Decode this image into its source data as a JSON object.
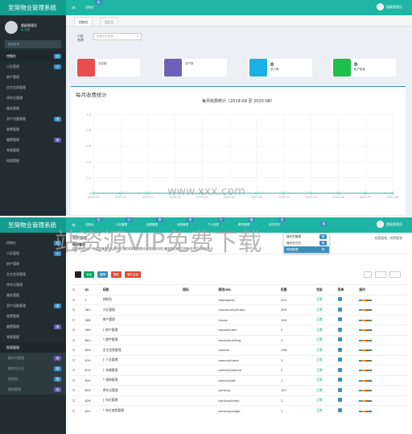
{
  "app": {
    "title": "至简物业管理系统",
    "admin_label": "超级管理员"
  },
  "top": {
    "user": {
      "name": "超级管理员",
      "status": "在线"
    },
    "search_placeholder": "搜索菜单",
    "menu": [
      {
        "label": "控制台",
        "badge": "控",
        "active": true
      },
      {
        "label": "小区管理",
        "badge": "小"
      },
      {
        "label": "房产管理"
      },
      {
        "label": "业主信息管理"
      },
      {
        "label": "停车位管理"
      },
      {
        "label": "服务管理"
      },
      {
        "label": "资产设备管理",
        "badge": "资"
      },
      {
        "label": "收费管理"
      },
      {
        "label": "缴费管理",
        "badge": "缴"
      },
      {
        "label": "常规管理"
      },
      {
        "label": "权限管理"
      }
    ],
    "hdr_tab": "控制台",
    "hdr_badge": "控",
    "tabs": [
      "控制台",
      "固定区"
    ],
    "select_label": "小区\n名称",
    "select_placeholder": "全部小区名称",
    "tiles": [
      {
        "value": "",
        "label": "总收款",
        "color": "#e84e4e"
      },
      {
        "value": "",
        "label": "总户数",
        "color": "#6e5fb8"
      },
      {
        "value": "0",
        "label": "总人数",
        "color": "#1ab0e3"
      },
      {
        "value": "0",
        "label": "租户数量",
        "color": "#1fbf4b"
      }
    ],
    "chart_section": "每月收费统计"
  },
  "chart_data": {
    "type": "line",
    "title": "每月收费统计（2019-09 至 2020-08）",
    "x": [
      "2019-09",
      "2019-10",
      "2019-11",
      "2019-12",
      "2020-01",
      "2020-02",
      "2020-03",
      "2020-04",
      "2020-05",
      "2020-06",
      "2020-07",
      "2020-08"
    ],
    "series": [
      {
        "values": [
          0,
          0,
          0,
          0,
          0,
          0,
          0,
          0,
          0,
          0,
          0,
          0
        ]
      }
    ],
    "yticks": [
      "1.0",
      "0.8",
      "0.6",
      "0.4",
      "0.2",
      "0"
    ],
    "ylim": [
      0,
      1
    ]
  },
  "bottom": {
    "hdr_nav": [
      {
        "label": "控制台",
        "badge": "控"
      },
      {
        "label": "小区管理",
        "badge": "小"
      },
      {
        "label": "房屋管理",
        "badge": "房"
      },
      {
        "label": "收费管理",
        "badge": "收"
      },
      {
        "label": "个人信息",
        "badge": "个"
      },
      {
        "label": "服务管理",
        "badge": "服"
      },
      {
        "label": "定时任务",
        "badge": "定"
      }
    ],
    "hdr_right_badge": "客",
    "dropdown": [
      {
        "label": "操作员管理",
        "badge": "操"
      },
      {
        "label": "操作员日志",
        "badge": "操"
      },
      {
        "label": "规则管理",
        "badge": "规"
      }
    ],
    "menu": [
      {
        "label": "控制台",
        "badge": "控"
      },
      {
        "label": "小区管理",
        "badge": "小"
      },
      {
        "label": "房产管理"
      },
      {
        "label": "业主信息管理"
      },
      {
        "label": "停车位管理"
      },
      {
        "label": "服务管理"
      },
      {
        "label": "资产设备管理",
        "badge": "资"
      },
      {
        "label": "收费管理"
      },
      {
        "label": "缴费管理",
        "badge": "缴"
      },
      {
        "label": "常规管理"
      },
      {
        "label": "权限管理",
        "active": true
      },
      {
        "label": "操作员管理",
        "badge": "操",
        "sub": true
      },
      {
        "label": "操作员日志",
        "badge": "操",
        "sub": true
      },
      {
        "label": "角色组",
        "badge": "角",
        "sub": true
      },
      {
        "label": "规则管理",
        "badge": "规",
        "sub": true
      }
    ],
    "page_title": "规则管理",
    "breadcrumb": [
      "权限管理",
      "规则管理"
    ],
    "notice": "规则通常对应一个控制器的方法,同时左侧的菜单栏数据也从规则中体现,通常建议通过控制台进行生成规则节点",
    "buttons": [
      {
        "label": "添加",
        "color": "#00a65a"
      },
      {
        "label": "编辑",
        "color": "#3c8dbc"
      },
      {
        "label": "删除",
        "color": "#dd4b39"
      },
      {
        "label": "展开全部",
        "color": "#dd4b39"
      }
    ],
    "columns": [
      "ID",
      "标题",
      "图标",
      "规则URL",
      "权重",
      "状态",
      "菜单",
      "操作"
    ],
    "rows": [
      {
        "id": "1",
        "title": "控制台",
        "url": "dashboard",
        "weight": "201",
        "status": "正常"
      },
      {
        "id": "581",
        "title": "小区管理",
        "url": "community/index",
        "weight": "200",
        "status": "正常"
      },
      {
        "id": "588",
        "title": "房产管理",
        "url": "house",
        "weight": "199",
        "status": "正常"
      },
      {
        "id": "599",
        "title": "├ 房产管理",
        "url": "house/index",
        "weight": "2",
        "status": "正常"
      },
      {
        "id": "604",
        "title": "└ 楼宇管理",
        "url": "house/building",
        "weight": "1",
        "status": "正常"
      },
      {
        "id": "609",
        "title": "业主信息管理",
        "url": "owners",
        "weight": "198",
        "status": "正常"
      },
      {
        "id": "610",
        "title": "├ 人员管理",
        "url": "owners/index",
        "weight": "3",
        "status": "正常"
      },
      {
        "id": "615",
        "title": "├ 车辆管理",
        "url": "owners/vehicle",
        "weight": "2",
        "status": "正常"
      },
      {
        "id": "620",
        "title": "└ 宠物管理",
        "url": "owners/pet",
        "weight": "1",
        "status": "正常"
      },
      {
        "id": "625",
        "title": "停车位管理",
        "url": "parking",
        "weight": "197",
        "status": "正常"
      },
      {
        "id": "626",
        "title": "├ 车位管理",
        "url": "parking/index",
        "weight": "2",
        "status": "正常"
      },
      {
        "id": "631",
        "title": "└ 车位使用管理",
        "url": "parking/usage",
        "weight": "1",
        "status": "正常"
      }
    ]
  },
  "watermark": {
    "url": "www.xxx.com",
    "text": "站资源VIP免费下载"
  }
}
